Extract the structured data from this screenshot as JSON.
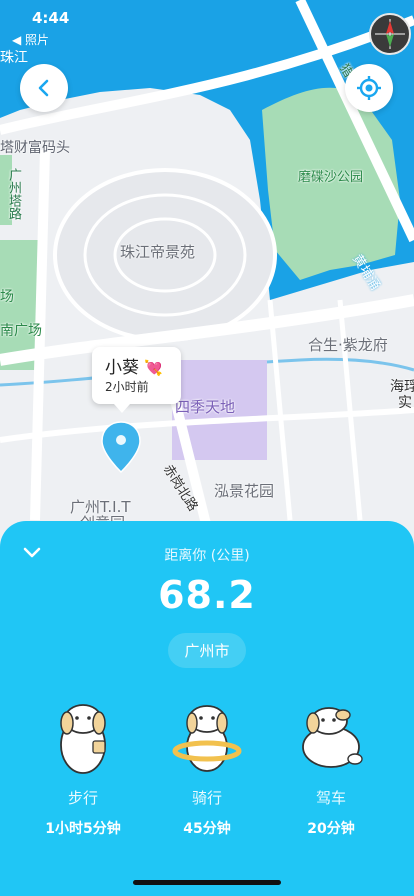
{
  "status": {
    "time": "4:44",
    "back_app": "◀ 照片"
  },
  "map": {
    "labels": {
      "pier": "塔财富码头",
      "pearl_river_short": "珠江",
      "guangzhou_ta_road": "广州塔路",
      "zhujiang_garden": "珠江帝景苑",
      "mosha_park": "磨碟沙公园",
      "huangpu_yong": "黄埔涌",
      "liede": "猎德",
      "hesheng": "合生·紫龙府",
      "sijitiandi": "四季天地",
      "chigang_north": "赤岗北路",
      "hongjing": "泓景花园",
      "tit": "广州T.I.T",
      "tit2": "创意园",
      "square": "南广场",
      "chang": "场",
      "haiqiu": "海琈",
      "shi": "实"
    }
  },
  "friend": {
    "name": "小葵",
    "emoji": "💘",
    "last_seen": "2小时前"
  },
  "sheet": {
    "distance_label": "距离你 (公里)",
    "distance_value": "68.2",
    "city": "广州市",
    "modes": [
      {
        "label": "步行",
        "time": "1小时5分钟"
      },
      {
        "label": "骑行",
        "time": "45分钟"
      },
      {
        "label": "驾车",
        "time": "20分钟"
      }
    ]
  },
  "colors": {
    "accent": "#20c6f5",
    "river": "#1aa2e6",
    "park": "#a7dcb6"
  }
}
